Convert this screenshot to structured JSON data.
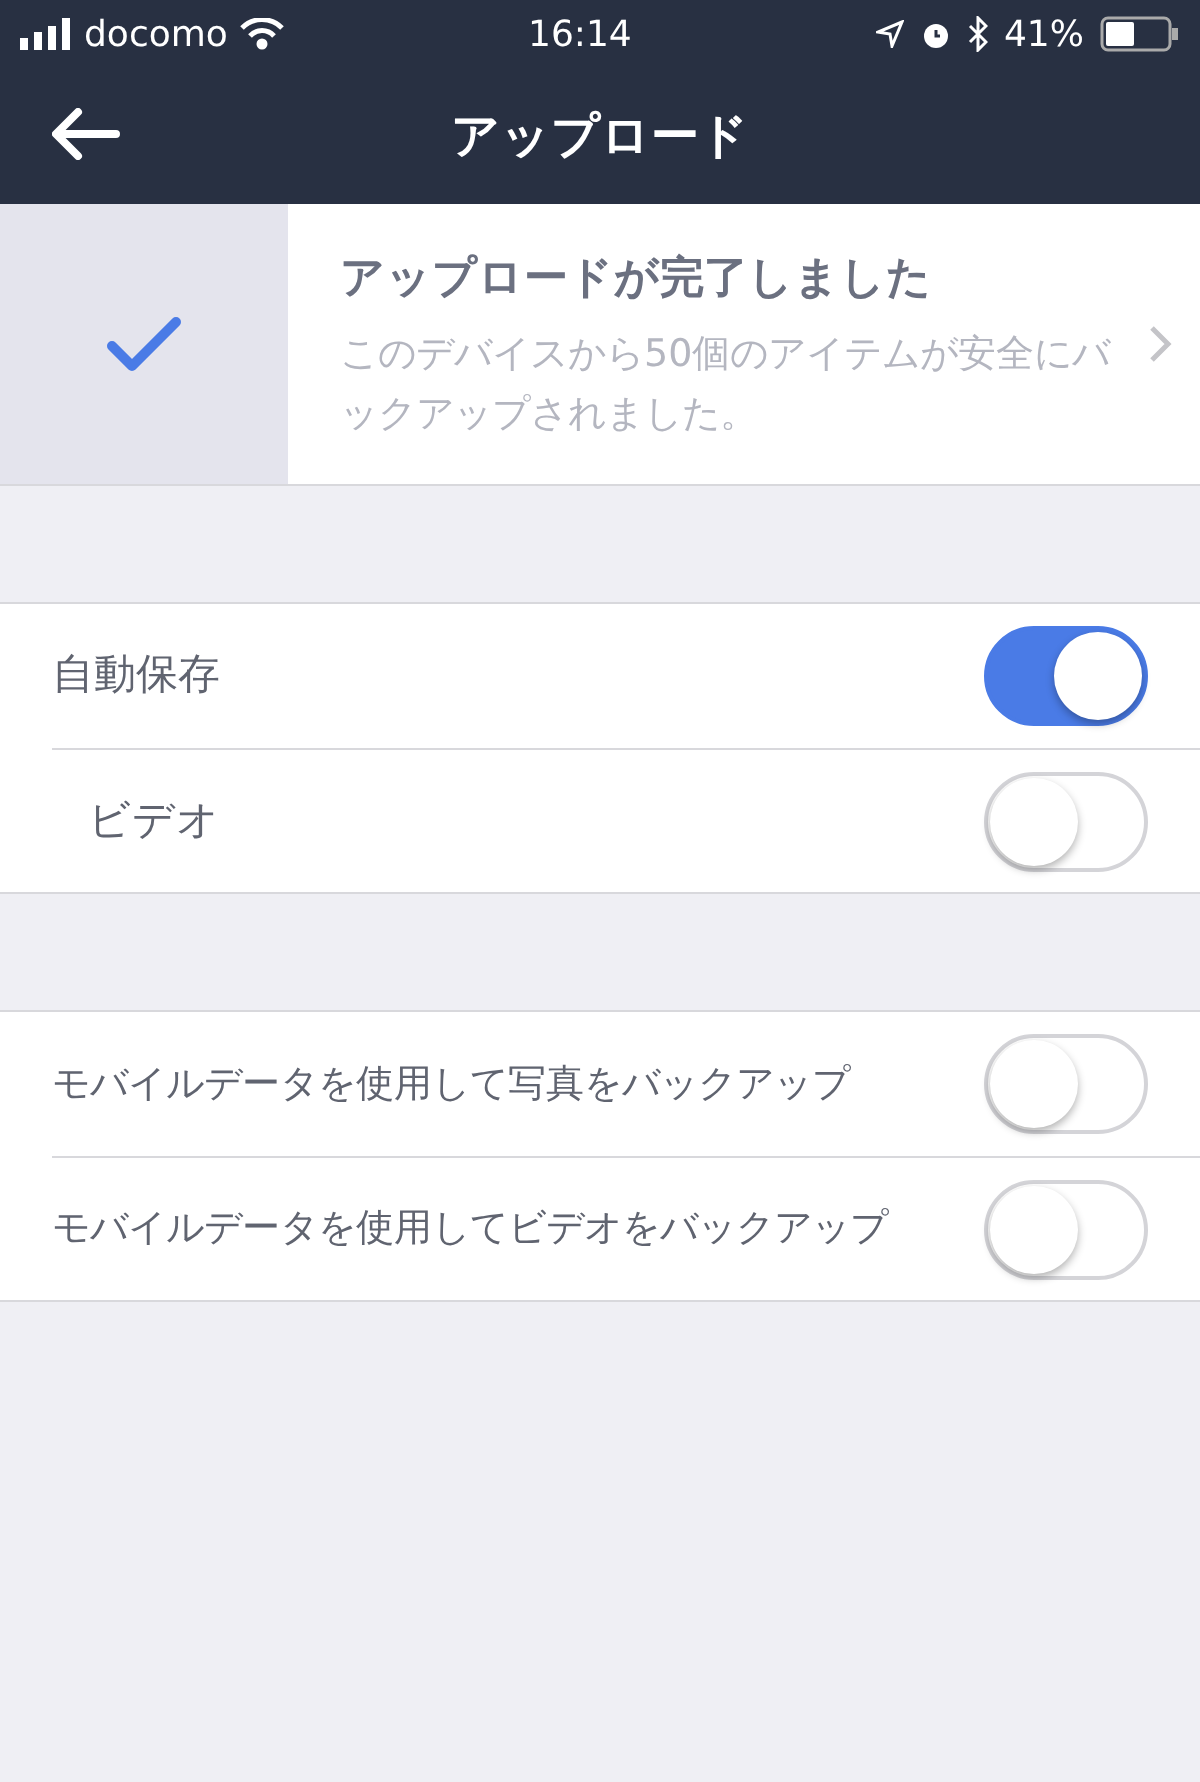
{
  "status_bar": {
    "carrier": "docomo",
    "time": "16:14",
    "battery": "41%"
  },
  "nav": {
    "title": "アップロード"
  },
  "banner": {
    "title": "アップロードが完了しました",
    "message": "このデバイスから50個のアイテムが安全にバックアップされました。"
  },
  "sections": [
    {
      "rows": [
        {
          "label": "自動保存",
          "kind": "main",
          "on": true
        },
        {
          "label": "ビデオ",
          "kind": "sub",
          "on": false
        }
      ]
    },
    {
      "rows": [
        {
          "label": "モバイルデータを使用して写真をバックアップ",
          "kind": "main",
          "on": false
        },
        {
          "label": "モバイルデータを使用してビデオをバックアップ",
          "kind": "main",
          "on": false
        }
      ]
    }
  ]
}
